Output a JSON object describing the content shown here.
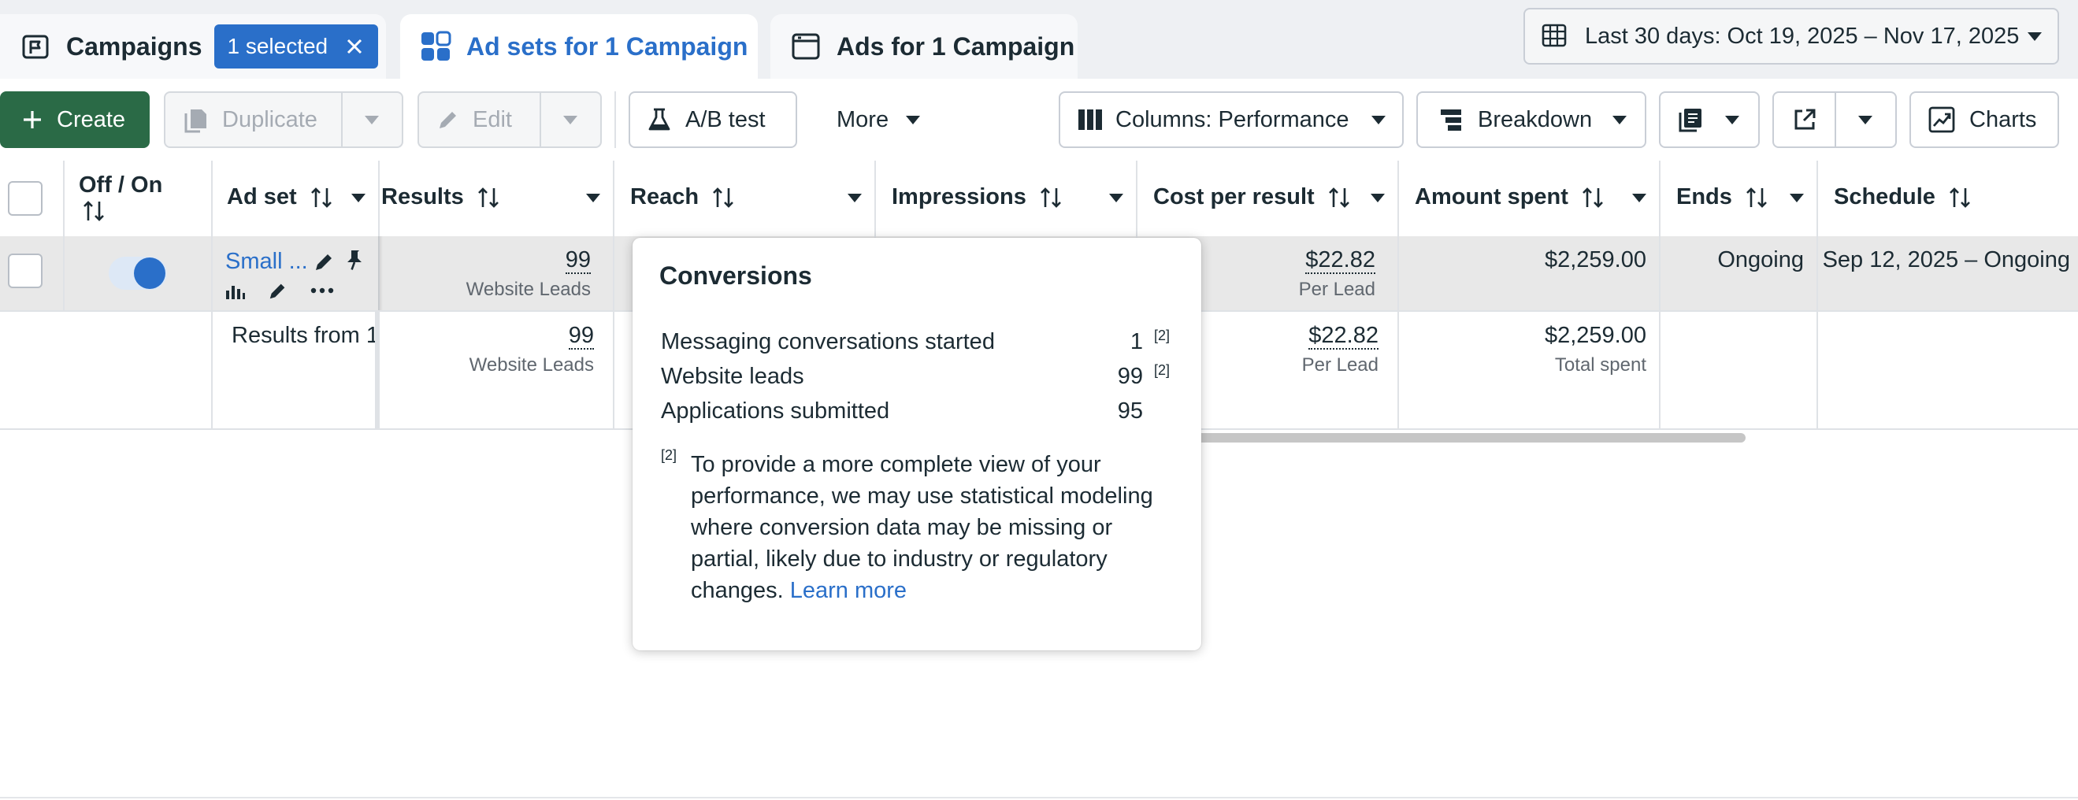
{
  "tabs": {
    "campaigns": {
      "label": "Campaigns",
      "selected_chip": "1 selected"
    },
    "adsets": {
      "label": "Ad sets for 1 Campaign"
    },
    "ads": {
      "label": "Ads for 1 Campaign"
    }
  },
  "date_range": {
    "label": "Last 30 days: Oct 19, 2025 – Nov 17, 2025"
  },
  "toolbar": {
    "create": "Create",
    "duplicate": "Duplicate",
    "edit": "Edit",
    "ab_test": "A/B test",
    "more": "More",
    "columns": "Columns: Performance",
    "breakdown": "Breakdown",
    "charts": "Charts"
  },
  "table": {
    "headers": {
      "off_on": "Off / On",
      "ad_set": "Ad set",
      "results": "Results",
      "reach": "Reach",
      "impressions": "Impressions",
      "cost_per_result": "Cost per result",
      "amount_spent": "Amount spent",
      "ends": "Ends",
      "schedule": "Schedule"
    },
    "row": {
      "name": "Small ...",
      "toggle_on": true,
      "results": "99",
      "results_sub": "Website Leads",
      "cost_per_result": "$22.82",
      "cost_sub": "Per Lead",
      "amount_spent": "$2,259.00",
      "ends": "Ongoing",
      "schedule": "Sep 12, 2025 – Ongoing"
    },
    "summary": {
      "label": "Results from 1",
      "results": "99",
      "results_sub": "Website Leads",
      "cost_per_result": "$22.82",
      "cost_sub": "Per Lead",
      "amount_spent": "$2,259.00",
      "amount_sub": "Total spent"
    }
  },
  "tooltip": {
    "title": "Conversions",
    "rows": [
      {
        "label": "Messaging conversations started",
        "value": "1",
        "footnote": "[2]"
      },
      {
        "label": "Website leads",
        "value": "99",
        "footnote": "[2]"
      },
      {
        "label": "Applications submitted",
        "value": "95",
        "footnote": ""
      }
    ],
    "note_marker": "[2]",
    "note_text": "To provide a more complete view of your performance, we may use statistical modeling where conversion data may be missing or partial, likely due to industry or regulatory changes.",
    "note_link": "Learn more"
  },
  "colors": {
    "accent_blue": "#2a6fc9",
    "create_green": "#2a6a46",
    "selected_row_bg": "#e8e8e8"
  },
  "icons": [
    "campaign-flag-icon",
    "adsets-grid-icon",
    "ad-frame-icon",
    "calendar-icon",
    "plus-icon",
    "duplicate-icon",
    "pencil-icon",
    "flask-icon",
    "columns-icon",
    "breakdown-icon",
    "reports-icon",
    "export-icon",
    "chart-icon",
    "sort-icon",
    "pin-icon",
    "bar-chart-icon",
    "more-dots-icon",
    "close-icon"
  ]
}
